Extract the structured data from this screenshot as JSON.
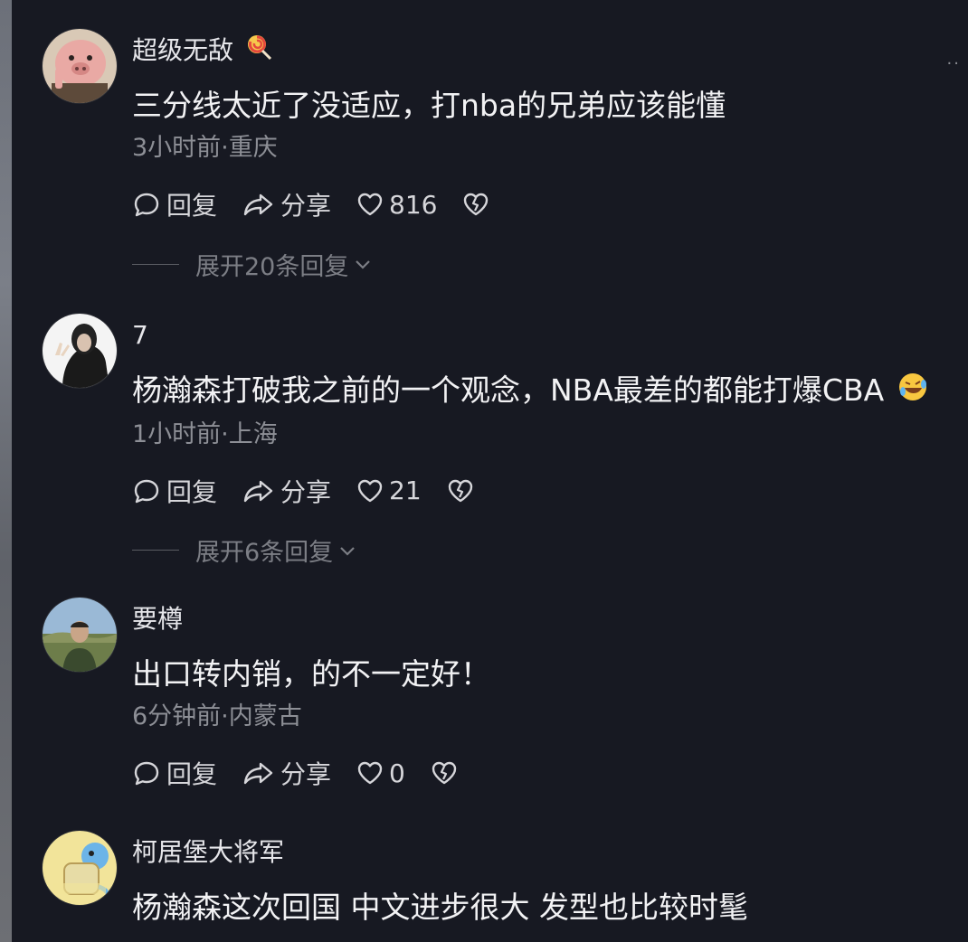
{
  "more_label": "··",
  "comments": [
    {
      "username": "超级无敌",
      "username_emoji": "lollipop-icon",
      "text": "三分线太近了没适应，打nba的兄弟应该能懂",
      "meta": "3小时前·重庆",
      "reply_label": "回复",
      "share_label": "分享",
      "likes": "816",
      "expand_label": "展开20条回复"
    },
    {
      "username": "7",
      "text": "杨瀚森打破我之前的一个观念，NBA最差的都能打爆CBA",
      "text_emoji": "rofl-emoji-icon",
      "meta": "1小时前·上海",
      "reply_label": "回复",
      "share_label": "分享",
      "likes": "21",
      "expand_label": "展开6条回复"
    },
    {
      "username": "要樽",
      "text": "出口转内销，的不一定好！",
      "meta": "6分钟前·内蒙古",
      "reply_label": "回复",
      "share_label": "分享",
      "likes": "0"
    },
    {
      "username": "柯居堡大将军",
      "text": "杨瀚森这次回国 中文进步很大 发型也比较时髦"
    }
  ]
}
